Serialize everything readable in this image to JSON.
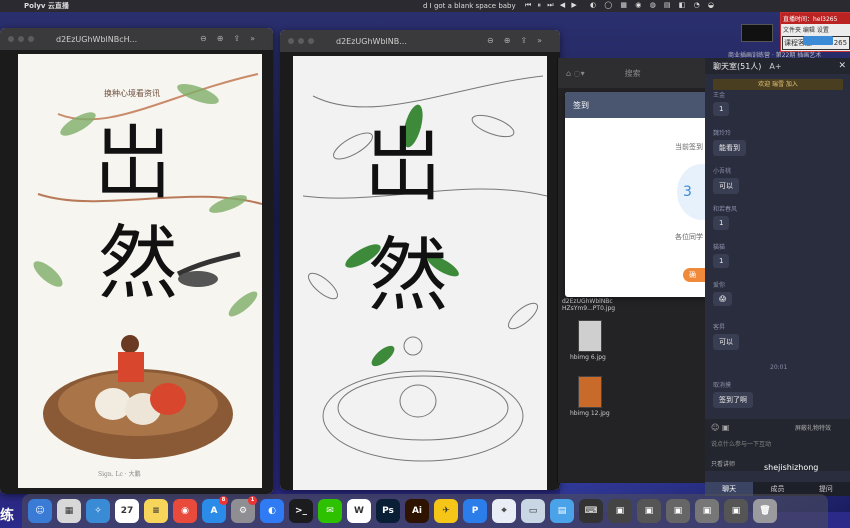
{
  "menubar": {
    "app_name": "Polyv 云直播",
    "song": "d I got a blank space baby",
    "controls": "⏮ ⏸ ⏭ ◀ ▶",
    "status_icons": "◐ ◯ ▦ ◉ ◍ ▤ ◧ ◔ ◒"
  },
  "preview_left": {
    "title": "d2EzUGhWblNBcH...",
    "poster_small_text": "换种心境看资讯",
    "poster_big_1": "岀",
    "poster_big_2": "然",
    "signature": "Sign. Lc · 大鹏"
  },
  "preview_right": {
    "title": "d2EzUGhWblNB...",
    "sketch_big_1": "岀",
    "sketch_big_2": "然"
  },
  "finder": {
    "search_placeholder": "搜索",
    "files": [
      {
        "name": "d2EzUGhWblNBc\nHZsYm9...PT0.jpg"
      },
      {
        "name": "hbimg 6.jpg"
      },
      {
        "name": "hbimg 12.jpg"
      }
    ]
  },
  "checkin_dialog": {
    "title": "签到",
    "line1": "当前签到",
    "number": "3",
    "line2": "各位同学",
    "button": "确"
  },
  "chat": {
    "title": "聊天室(51人)",
    "font_label": "A+",
    "welcome": "欢迎 瑞雪 加入",
    "messages": [
      {
        "name": "王金",
        "text": "1"
      },
      {
        "name": "魏玲玲",
        "text": "能看到"
      },
      {
        "name": "小吾桃",
        "text": "可以"
      },
      {
        "name": "和若春风",
        "text": "1"
      },
      {
        "name": "猫猫",
        "text": "1"
      },
      {
        "name": "爱你",
        "text": "😱"
      },
      {
        "name": "客昇",
        "text": "可以"
      },
      {
        "name": "取消摸",
        "text": "签到了啊"
      }
    ],
    "timestamp": "20:01",
    "input_placeholder": "说点什么参与一下互动",
    "only_teacher": "只看讲师",
    "block_gifts": "屏蔽礼物特效",
    "tabs": [
      "聊天",
      "成员",
      "提问"
    ]
  },
  "recording": {
    "line1": "直播时间：hel3265",
    "line2": "文件夹  编辑  设置",
    "line3": "课程客服V:hel3265"
  },
  "training_text": "商业插画训练营 · 第22期 插画艺术",
  "watermark": "shejishizhong",
  "overlay_char": "练",
  "dock": {
    "apps": [
      {
        "name": "finder",
        "label": "☺",
        "color": "#3a7bd5"
      },
      {
        "name": "launchpad",
        "label": "▦",
        "color": "#d8d8d8"
      },
      {
        "name": "safari",
        "label": "✧",
        "color": "#3a8bd6"
      },
      {
        "name": "calendar",
        "label": "27",
        "color": "#ffffff"
      },
      {
        "name": "notes",
        "label": "≡",
        "color": "#f7d45a"
      },
      {
        "name": "chrome",
        "label": "◉",
        "color": "#e84b3c"
      },
      {
        "name": "app-store",
        "label": "A",
        "color": "#2b8be8",
        "badge": "8"
      },
      {
        "name": "system-settings",
        "label": "⚙",
        "color": "#8e8e93",
        "badge": "1"
      },
      {
        "name": "lark",
        "label": "◐",
        "color": "#2f7bf4"
      },
      {
        "name": "terminal",
        "label": ">_",
        "color": "#1c1c1e"
      },
      {
        "name": "wechat",
        "label": "✉",
        "color": "#2dc100"
      },
      {
        "name": "wps",
        "label": "W",
        "color": "#ffffff"
      },
      {
        "name": "photoshop",
        "label": "Ps",
        "color": "#0a1e35"
      },
      {
        "name": "illustrator",
        "label": "Ai",
        "color": "#2e1300"
      },
      {
        "name": "clash",
        "label": "✈",
        "color": "#f5c518"
      },
      {
        "name": "polyv",
        "label": "P",
        "color": "#2b7de9"
      },
      {
        "name": "preview",
        "label": "⌖",
        "color": "#e9eef6"
      },
      {
        "name": "screenshot",
        "label": "▭",
        "color": "#c9d6e3"
      },
      {
        "name": "folder",
        "label": "▤",
        "color": "#4aa3e8"
      },
      {
        "name": "keyboard",
        "label": "⌨",
        "color": "#333333"
      },
      {
        "name": "image-1",
        "label": "▣",
        "color": "#444444"
      },
      {
        "name": "image-2",
        "label": "▣",
        "color": "#555555"
      },
      {
        "name": "image-3",
        "label": "▣",
        "color": "#666666"
      },
      {
        "name": "image-4",
        "label": "▣",
        "color": "#777777"
      },
      {
        "name": "image-5",
        "label": "▣",
        "color": "#555555"
      },
      {
        "name": "trash",
        "label": "🗑",
        "color": "#9a9a9f"
      }
    ]
  }
}
